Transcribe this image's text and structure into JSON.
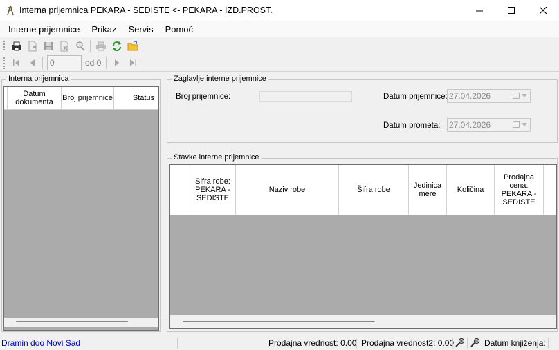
{
  "window": {
    "title": "Interna prijemnica   PEKARA - SEDISTE <- PEKARA - IZD.PROST."
  },
  "menu": [
    "Interne prijemnice",
    "Prikaz",
    "Servis",
    "Pomoć"
  ],
  "navigator": {
    "position": "0",
    "of_label": "od 0"
  },
  "left_panel": {
    "title": "Interna prijemnica",
    "columns": [
      "Datum dokumenta",
      "Broj prijemnice",
      "Status"
    ]
  },
  "header_group": {
    "title": "Zaglavlje interne prijemnice",
    "broj_label": "Broj prijemnice:",
    "datum_prijemnice_label": "Datum prijemnice:",
    "datum_prijemnice_value": "27.04.2026",
    "datum_prometa_label": "Datum prometa:",
    "datum_prometa_value": "27.04.2026"
  },
  "items_group": {
    "title": "Stavke interne prijemnice",
    "columns": [
      "Sifra robe: PEKARA - SEDISTE",
      "Naziv robe",
      "Šifra robe",
      "Jedinica mere",
      "Količina",
      "Prodajna cena: PEKARA - SEDISTE"
    ]
  },
  "status": {
    "company": "Dramin doo Novi Sad",
    "prodajna_vrednost": "Prodajna vrednost: 0.00",
    "prodajna_vrednost2": "Prodajna vrednost2: 0.00",
    "datum_knjizenja": "Datum knjiženja:"
  },
  "colors": {
    "grid_bg": "#ababab",
    "link": "#0000cc",
    "window_bg": "#f0f0f0"
  }
}
